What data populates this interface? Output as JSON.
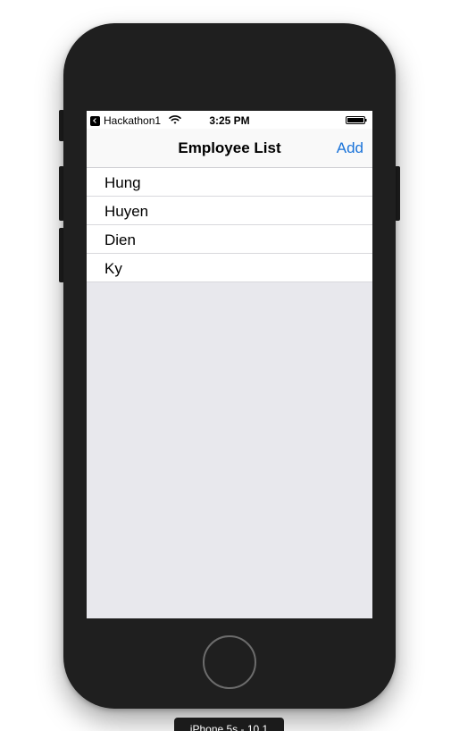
{
  "status_bar": {
    "back_app_label": "Hackathon1",
    "time": "3:25 PM",
    "icons": [
      "back-arrow-icon",
      "wifi-icon",
      "battery-icon"
    ]
  },
  "nav": {
    "title": "Employee List",
    "add_label": "Add"
  },
  "employees": [
    "Hung",
    "Huyen",
    "Dien",
    "Ky"
  ],
  "device_label": "iPhone 5s - 10.1",
  "colors": {
    "accent": "#1a73d9",
    "device_body": "#1f1f1f",
    "screen_background": "#e8e8ed"
  }
}
